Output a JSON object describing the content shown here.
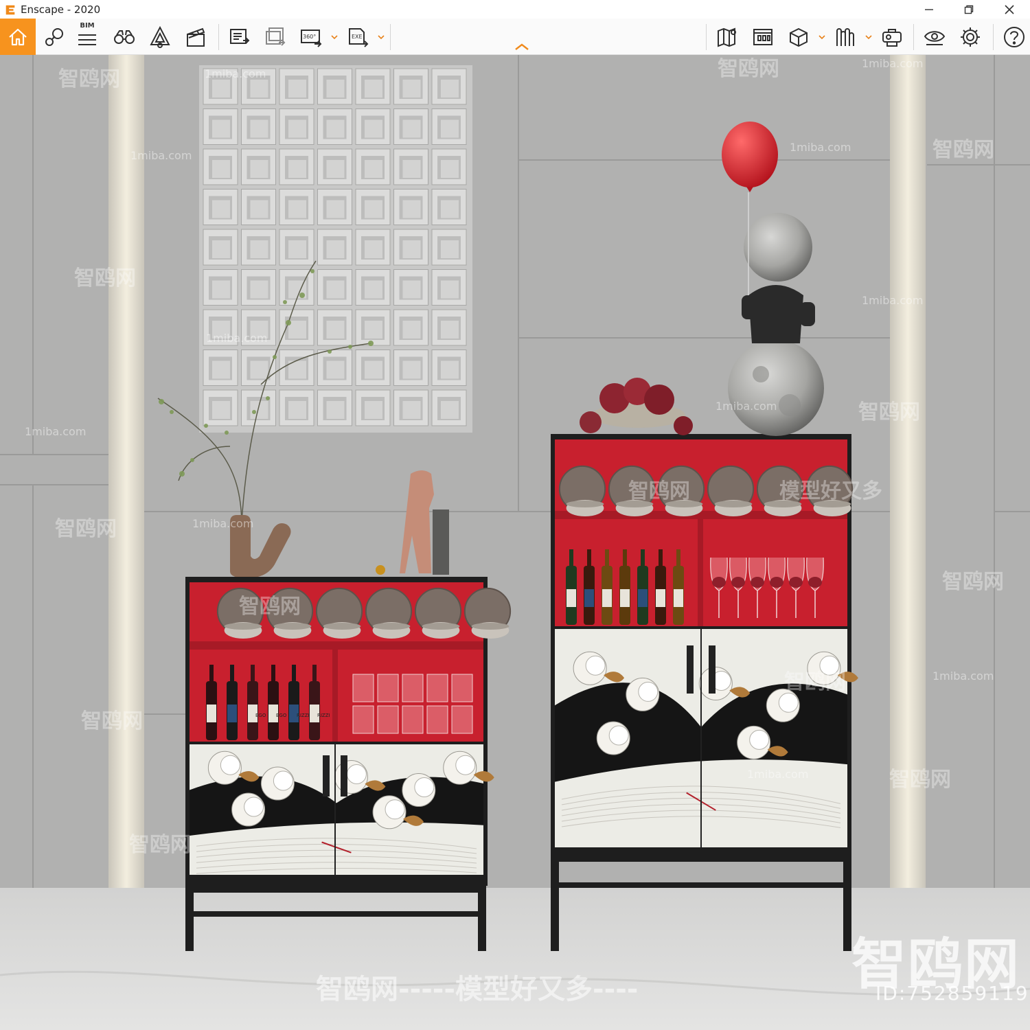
{
  "window": {
    "title": "Enscape - 2020",
    "controls": [
      "minimize",
      "restore",
      "close"
    ]
  },
  "toolbar": {
    "bim_label": "BIM",
    "icons": [
      "home-icon",
      "view-management-icon",
      "bim-icon",
      "binoculars-icon",
      "visual-settings-icon",
      "video-editor-icon",
      "screenshot-icon",
      "batch-render-icon",
      "panorama-360-icon",
      "exe-export-icon",
      "map-icon",
      "capture-gallery-icon",
      "asset-library-icon",
      "material-editor-icon",
      "vr-headset-icon",
      "eye-icon",
      "settings-icon",
      "help-icon"
    ],
    "accent": "#f7931e"
  },
  "scene": {
    "watermarks": {
      "site_cn": "智鸥网",
      "site_en": "1miba.com",
      "slogan": "模型好又多",
      "bottom_line": "智鸥网-----模型好又多----",
      "logo": "智鸥网",
      "id": "ID:752859119"
    },
    "labels": {
      "bottle_1": "EGO",
      "bottle_2": "EGO",
      "bottle_3": "RIZZI",
      "bottle_4": "RIZZI"
    },
    "colors": {
      "wall": "#b0b0af",
      "cabinet_interior": "#c8202e",
      "cabinet_frame": "#1e1e1e",
      "floor": "#d9d9d8"
    }
  }
}
